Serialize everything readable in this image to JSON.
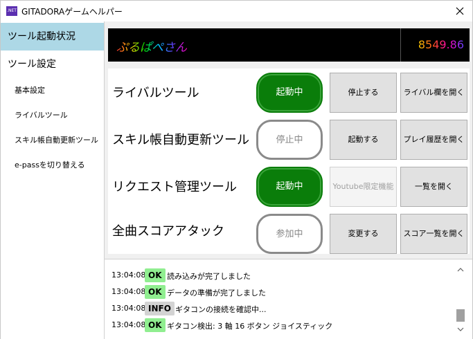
{
  "window": {
    "app_icon_text": ".NET",
    "title": "GITADORAゲームヘルパー"
  },
  "sidebar": {
    "items": [
      {
        "label": "ツール起動状況",
        "active": true
      },
      {
        "label": "ツール設定",
        "active": false
      },
      {
        "label": "基本設定",
        "active": false
      },
      {
        "label": "ライバルツール",
        "active": false
      },
      {
        "label": "スキル帳自動更新ツール",
        "active": false
      },
      {
        "label": "e-passを切り替える",
        "active": false
      }
    ]
  },
  "header": {
    "player_name": "ぷるぱぺさん",
    "skill": "8549.86"
  },
  "tools": [
    {
      "name": "ライバルツール",
      "status": "起動中",
      "status_on": true,
      "action_a": "停止する",
      "action_b": "ライバル欄を開く",
      "action_a_disabled": false
    },
    {
      "name": "スキル帳自動更新ツール",
      "status": "停止中",
      "status_on": false,
      "action_a": "起動する",
      "action_b": "プレイ履歴を開く",
      "action_a_disabled": false
    },
    {
      "name": "リクエスト管理ツール",
      "status": "起動中",
      "status_on": true,
      "action_a": "Youtube限定機能",
      "action_b": "一覧を開く",
      "action_a_disabled": true
    },
    {
      "name": "全曲スコアアタック",
      "status": "参加中",
      "status_on": false,
      "action_a": "変更する",
      "action_b": "スコア一覧を開く",
      "action_a_disabled": false
    }
  ],
  "log": [
    {
      "time": "13:04:08",
      "level": "OK",
      "message": "読み込みが完了しました"
    },
    {
      "time": "13:04:08",
      "level": "OK",
      "message": "データの準備が完了しました"
    },
    {
      "time": "13:04:08",
      "level": "INFO",
      "message": "ギタコンの接続を確認中..."
    },
    {
      "time": "13:04:08",
      "level": "OK",
      "message": "ギタコン検出: 3 軸 16 ボタン ジョイスティック"
    }
  ],
  "colors": {
    "active_nav": "#add8e6",
    "status_on": "#0a7d0a",
    "ok_badge": "#90ee90",
    "info_badge": "#d3d3d3"
  },
  "icons": {
    "close": "close-icon",
    "app": "dotnet-app-icon",
    "scroll_up": "chevron-up-icon",
    "scroll_down": "chevron-down-icon"
  }
}
